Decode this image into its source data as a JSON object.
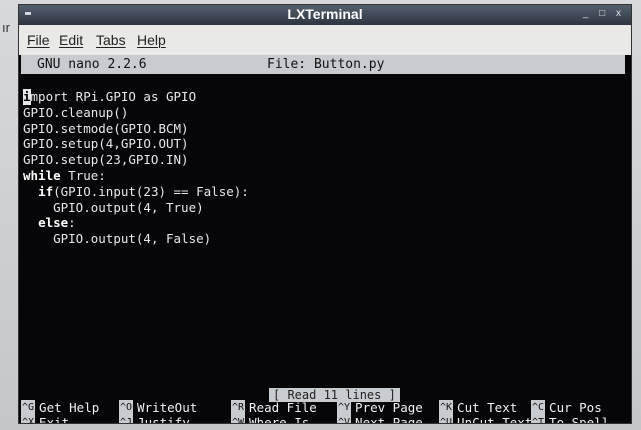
{
  "side_text": "ır",
  "window": {
    "title": "LXTerminal",
    "buttons": "_ □ x"
  },
  "menubar": {
    "items": [
      "File",
      "Edit",
      "Tabs",
      "Help"
    ]
  },
  "nano": {
    "version": "GNU nano 2.2.6",
    "file": "File: Button.py",
    "status": "[ Read 11 lines ]"
  },
  "code": {
    "lines": [
      {
        "prefix": "",
        "cursor": "i",
        "kw": "",
        "rest": "mport RPi.GPIO as GPIO"
      },
      {
        "prefix": "",
        "cursor": "",
        "kw": "",
        "rest": "GPIO.cleanup()"
      },
      {
        "prefix": "",
        "cursor": "",
        "kw": "",
        "rest": "GPIO.setmode(GPIO.BCM)"
      },
      {
        "prefix": "",
        "cursor": "",
        "kw": "",
        "rest": "GPIO.setup(4,GPIO.OUT)"
      },
      {
        "prefix": "",
        "cursor": "",
        "kw": "",
        "rest": "GPIO.setup(23,GPIO.IN)"
      },
      {
        "prefix": "",
        "cursor": "",
        "kw": "while",
        "rest": " True:"
      },
      {
        "prefix": "  ",
        "cursor": "",
        "kw": "if",
        "rest": "(GPIO.input(23) == False):"
      },
      {
        "prefix": "    ",
        "cursor": "",
        "kw": "",
        "rest": "GPIO.output(4, True)"
      },
      {
        "prefix": "  ",
        "cursor": "",
        "kw": "else",
        "rest": ":"
      },
      {
        "prefix": "    ",
        "cursor": "",
        "kw": "",
        "rest": "GPIO.output(4, False)"
      }
    ]
  },
  "shortcuts": [
    {
      "key": "^G",
      "label": "Get Help"
    },
    {
      "key": "^O",
      "label": "WriteOut"
    },
    {
      "key": "^R",
      "label": "Read File"
    },
    {
      "key": "^Y",
      "label": "Prev Page"
    },
    {
      "key": "^K",
      "label": "Cut Text"
    },
    {
      "key": "^C",
      "label": "Cur Pos"
    },
    {
      "key": "^X",
      "label": "Exit"
    },
    {
      "key": "^J",
      "label": "Justify"
    },
    {
      "key": "^W",
      "label": "Where Is"
    },
    {
      "key": "^V",
      "label": "Next Page"
    },
    {
      "key": "^U",
      "label": "UnCut Text"
    },
    {
      "key": "^T",
      "label": "To Spell"
    }
  ]
}
